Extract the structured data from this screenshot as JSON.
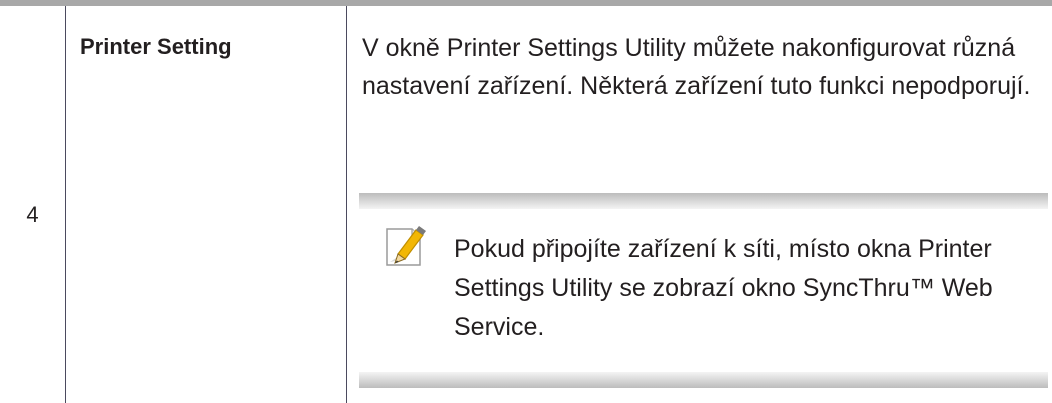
{
  "row": {
    "number": "4",
    "name": "Printer Setting",
    "description": "V okně Printer Settings Utility můžete nakonfigurovat různá nastavení zařízení. Některá zařízení tuto funkci nepodporují."
  },
  "note": {
    "icon": "note-pencil-icon",
    "text": "Pokud připojíte zařízení k síti, místo okna Printer Settings Utility se zobrazí okno SyncThru™ Web Service."
  },
  "colors": {
    "rule": "#a8a8a8",
    "divider": "#4b4a5e",
    "text": "#231f20",
    "icon_accent": "#f2b705"
  }
}
